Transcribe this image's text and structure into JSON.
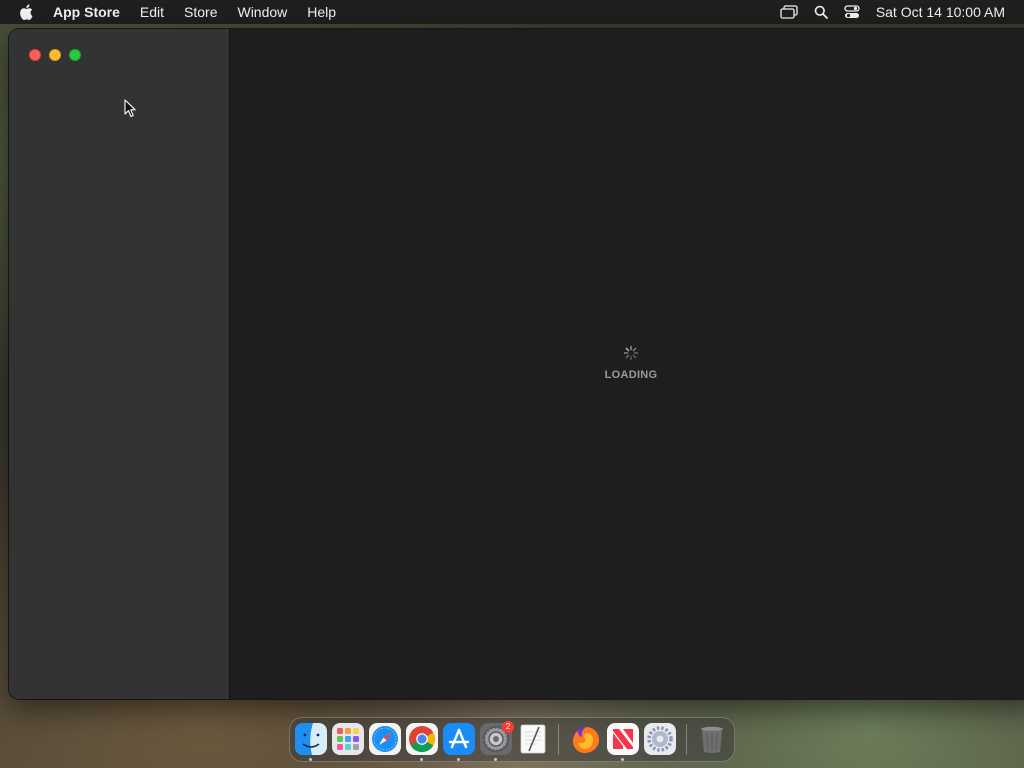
{
  "menubar": {
    "app_name": "App Store",
    "items": [
      "Edit",
      "Store",
      "Window",
      "Help"
    ],
    "clock": "Sat Oct 14  10:00 AM",
    "status_icons": [
      "screen-mirroring-icon",
      "search-icon",
      "control-center-icon"
    ]
  },
  "window": {
    "loading_text": "LOADING"
  },
  "dock": {
    "apps": [
      {
        "name": "Finder",
        "icon": "finder-icon",
        "running": true
      },
      {
        "name": "Launchpad",
        "icon": "launchpad-icon",
        "running": false
      },
      {
        "name": "Safari",
        "icon": "safari-icon",
        "running": false
      },
      {
        "name": "Google Chrome",
        "icon": "chrome-icon",
        "running": true
      },
      {
        "name": "App Store",
        "icon": "app-store-icon",
        "running": true
      },
      {
        "name": "System Preferences",
        "icon": "system-preferences-icon",
        "running": true,
        "badge": "2"
      },
      {
        "name": "TextEdit",
        "icon": "textedit-icon",
        "running": false
      },
      {
        "name": "Firefox",
        "icon": "firefox-icon",
        "running": false
      },
      {
        "name": "News",
        "icon": "news-icon",
        "running": true
      },
      {
        "name": "Settings",
        "icon": "settings-icon",
        "running": false
      },
      {
        "name": "Trash",
        "icon": "trash-icon",
        "running": false
      }
    ]
  },
  "colors": {
    "menubar_bg": "#1f1f1f",
    "sidebar_bg": "#333333",
    "content_bg": "#1e1e1e",
    "close": "#fe5f57",
    "minimize": "#febc2e",
    "zoom": "#28c840",
    "badge": "#ff3b30"
  }
}
